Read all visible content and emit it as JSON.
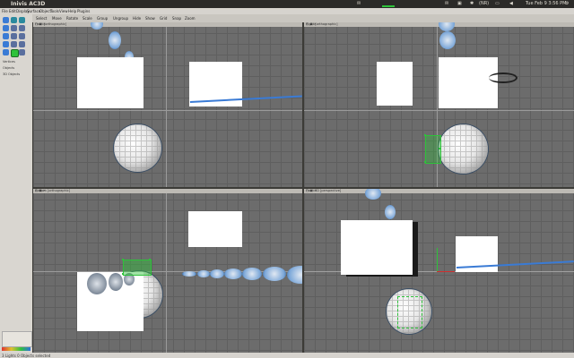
{
  "window": {
    "title": "Inivis AC3D"
  },
  "system": {
    "clock": "Tue Feb 9 3:56 PM",
    "network": "(NR)",
    "indicators": [
      "mail",
      "bluetooth",
      "battery",
      "volume"
    ]
  },
  "menubar": {
    "items": [
      "File",
      "Edit",
      "Display",
      "Surface",
      "Object",
      "Tools",
      "View",
      "Help",
      "Plugins"
    ]
  },
  "toolbar": {
    "items": [
      "Select",
      "Move",
      "Rotate",
      "Scale",
      "Group",
      "Ungroup",
      "Hide",
      "Show",
      "Grid",
      "Snap",
      "Zoom"
    ]
  },
  "viewports": [
    {
      "name": "Front [orthographic]",
      "controls": "▢ ▣ ✕"
    },
    {
      "name": "Right [orthographic]",
      "controls": "▢ ▣ ✕"
    },
    {
      "name": "Bottom [orthographic]",
      "controls": "▢ ▣ ✕"
    },
    {
      "name": "Front 3D [perspective]",
      "controls": "▢ ▣ ✕"
    }
  ],
  "leftpanel": {
    "group_label": "Vertices",
    "mode_label": "Objects",
    "info_label": "3D Objects"
  },
  "statusbar": {
    "text": "3 Lights   0 Objects selected"
  },
  "colors": {
    "selection": "#2ec23a",
    "grid": "#6c6c6c",
    "panel": "#d9d6d0",
    "accent": "#3a7bd5"
  }
}
